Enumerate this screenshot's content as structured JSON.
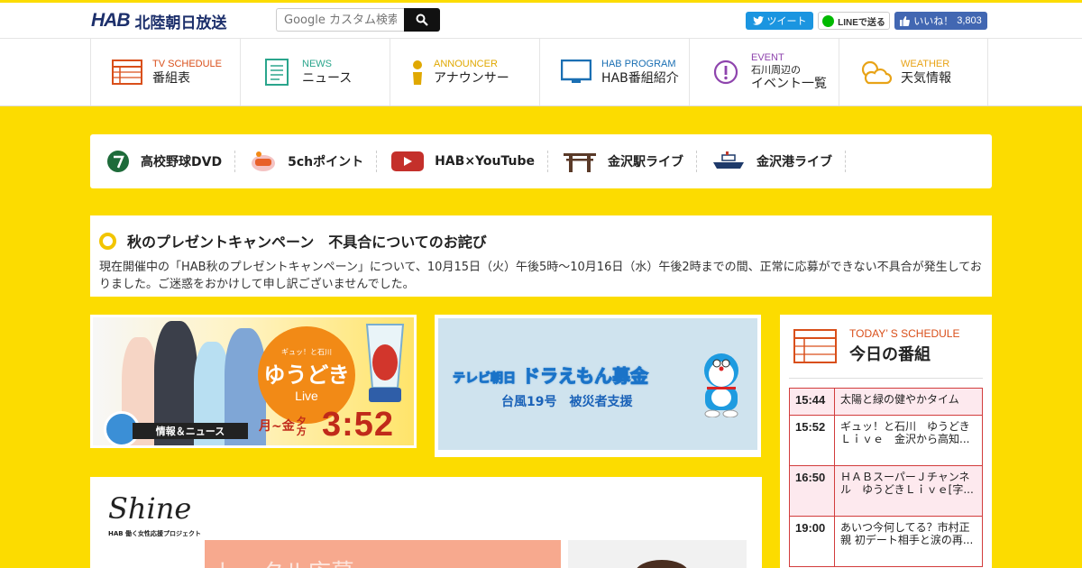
{
  "header": {
    "logo_mark": "HAB",
    "logo_name": "北陸朝日放送",
    "search_placeholder": "Google カスタム検索",
    "tweet_label": "ツイート",
    "line_label": "LINEで送る",
    "like_label": "いいね！",
    "like_count": "3,803"
  },
  "nav": [
    {
      "en": "TV SCHEDULE",
      "ja": "番組表",
      "color": "#d94f1a",
      "icon": "tv-schedule-icon"
    },
    {
      "en": "NEWS",
      "ja": "ニュース",
      "color": "#2aa58c",
      "icon": "news-icon"
    },
    {
      "en": "ANNOUNCER",
      "ja": "アナウンサー",
      "color": "#e0a800",
      "icon": "announcer-icon"
    },
    {
      "en": "HAB PROGRAM",
      "ja": "HAB番組紹介",
      "color": "#1a6fb3",
      "icon": "monitor-icon"
    },
    {
      "en": "EVENT",
      "sub": "石川周辺の",
      "ja": "イベント一覧",
      "color": "#8e44ad",
      "icon": "exclamation-icon"
    },
    {
      "en": "WEATHER",
      "ja": "天気情報",
      "color": "#e8a317",
      "icon": "weather-icon"
    }
  ],
  "quick_links": [
    {
      "label": "高校野球DVD",
      "icon": "baseball-icon"
    },
    {
      "label": "5chポイント",
      "icon": "5ch-point-icon"
    },
    {
      "label": "HAB×YouTube",
      "icon": "youtube-icon"
    },
    {
      "label": "金沢駅ライブ",
      "icon": "torii-gate-icon"
    },
    {
      "label": "金沢港ライブ",
      "icon": "ship-icon"
    }
  ],
  "notice": {
    "title": "秋のプレゼントキャンペーン　不具合についてのお詫び",
    "body": "現在開催中の「HAB秋のプレゼントキャンペーン」について、10月15日（火）午後5時～10月16日（水）午後2時までの間、正常に応募ができない不具合が発生しておりました。ご迷惑をおかけして申し訳ございませんでした。"
  },
  "banner_yudoki": {
    "small": "ギュッ！と石川",
    "title": "ゆうどき",
    "live": "Live",
    "strip": "情報＆ニュース",
    "days": "月~金",
    "evening": "夕方",
    "time": "3:52"
  },
  "banner_dora": {
    "title_small": "テレビ朝日",
    "title": "ドラえもん募金",
    "sub": "台風19号　被災者支援"
  },
  "shine": {
    "logo": "Shine",
    "sub": "HAB 働く女性応援プロジェクト",
    "pink_text": "トータル応募"
  },
  "schedule": {
    "en": "TODAY’ S SCHEDULE",
    "ja": "今日の番組",
    "items": [
      {
        "time": "15:44",
        "title": "太陽と緑の健やかタイム"
      },
      {
        "time": "15:52",
        "title": "ギュッ！と石川　ゆうどきＬｉｖｅ　金沢から高知..."
      },
      {
        "time": "16:50",
        "title": "ＨＡＢスーパーＪチャンネル　ゆうどきＬｉｖｅ[字..."
      },
      {
        "time": "19:00",
        "title": "あいつ今何してる？市村正親 初デート相手と涙の再..."
      }
    ]
  }
}
